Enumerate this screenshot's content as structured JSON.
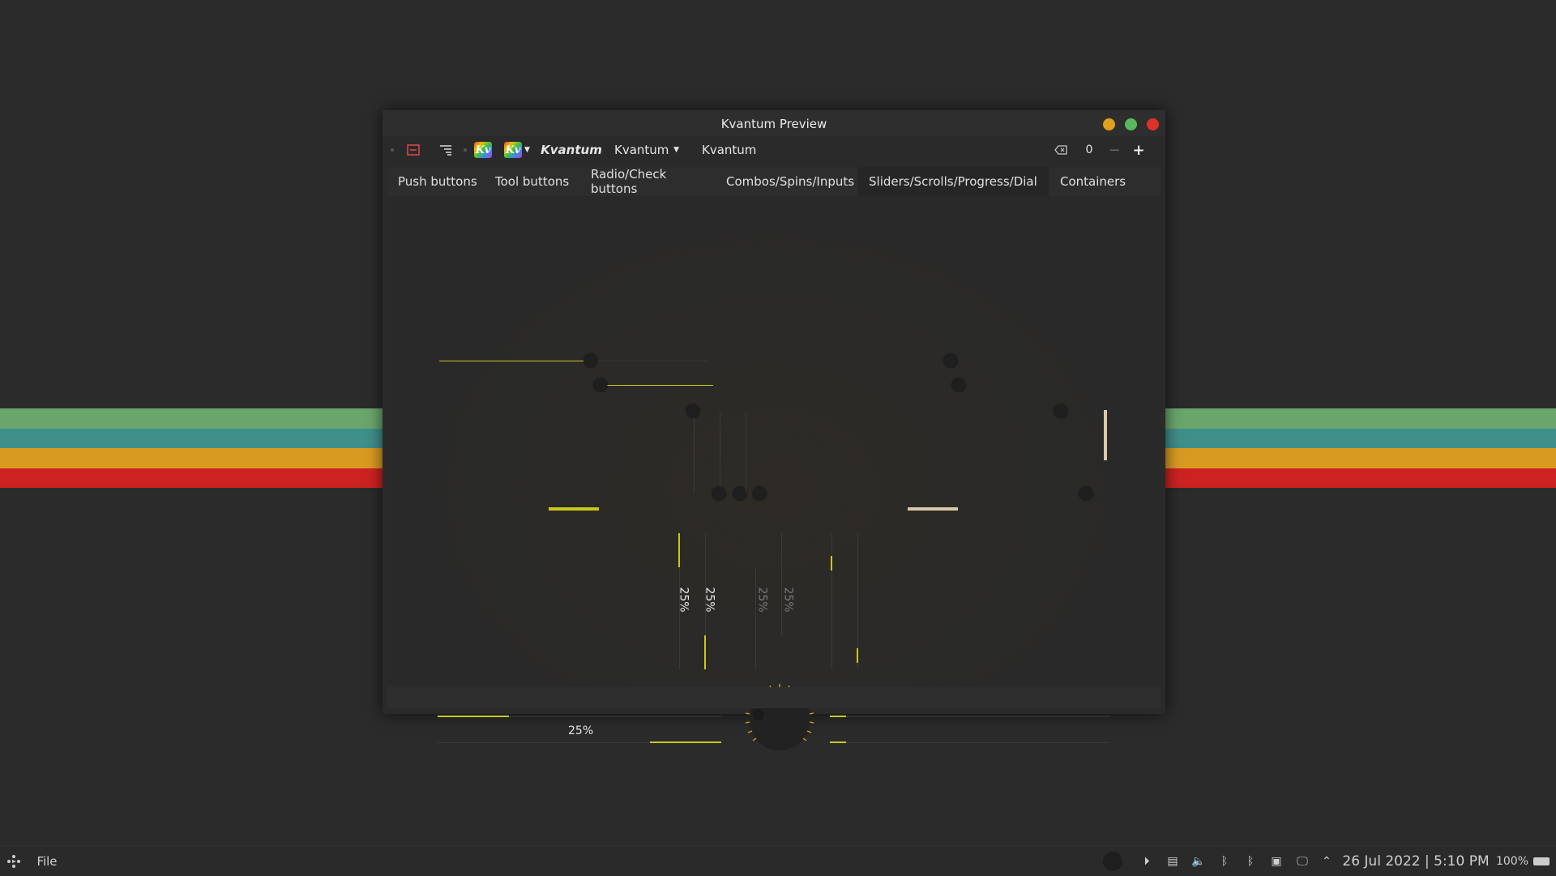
{
  "desktop": {
    "stripe_colors": [
      "#6aa66c",
      "#3f8f8b",
      "#d99a22",
      "#cc2222"
    ]
  },
  "window": {
    "title": "Kvantum Preview",
    "buttons": [
      {
        "name": "minimize",
        "color": "#e0a020"
      },
      {
        "name": "maximize",
        "color": "#5cb85c"
      },
      {
        "name": "close",
        "color": "#e0302a"
      }
    ]
  },
  "toolbar": {
    "kvantum_label": "Kvantum",
    "combo_value": "Kvantum",
    "lineedit_value": "Kvantum",
    "spin_value": "0"
  },
  "tabs": [
    {
      "label": "Push buttons"
    },
    {
      "label": "Tool buttons"
    },
    {
      "label": "Radio/Check buttons"
    },
    {
      "label": "Combos/Spins/Inputs"
    },
    {
      "label": "Sliders/Scrolls/Progress/Dial",
      "active": true
    },
    {
      "label": "Containers"
    }
  ],
  "progress": {
    "value_percent": 25,
    "label": "25%"
  },
  "taskbar": {
    "menu_label": "File",
    "datetime": "26 Jul 2022 | 5:10 PM",
    "battery": "100%"
  },
  "colors": {
    "accent": "#c8c818",
    "secondary": "#d9c9a6"
  }
}
